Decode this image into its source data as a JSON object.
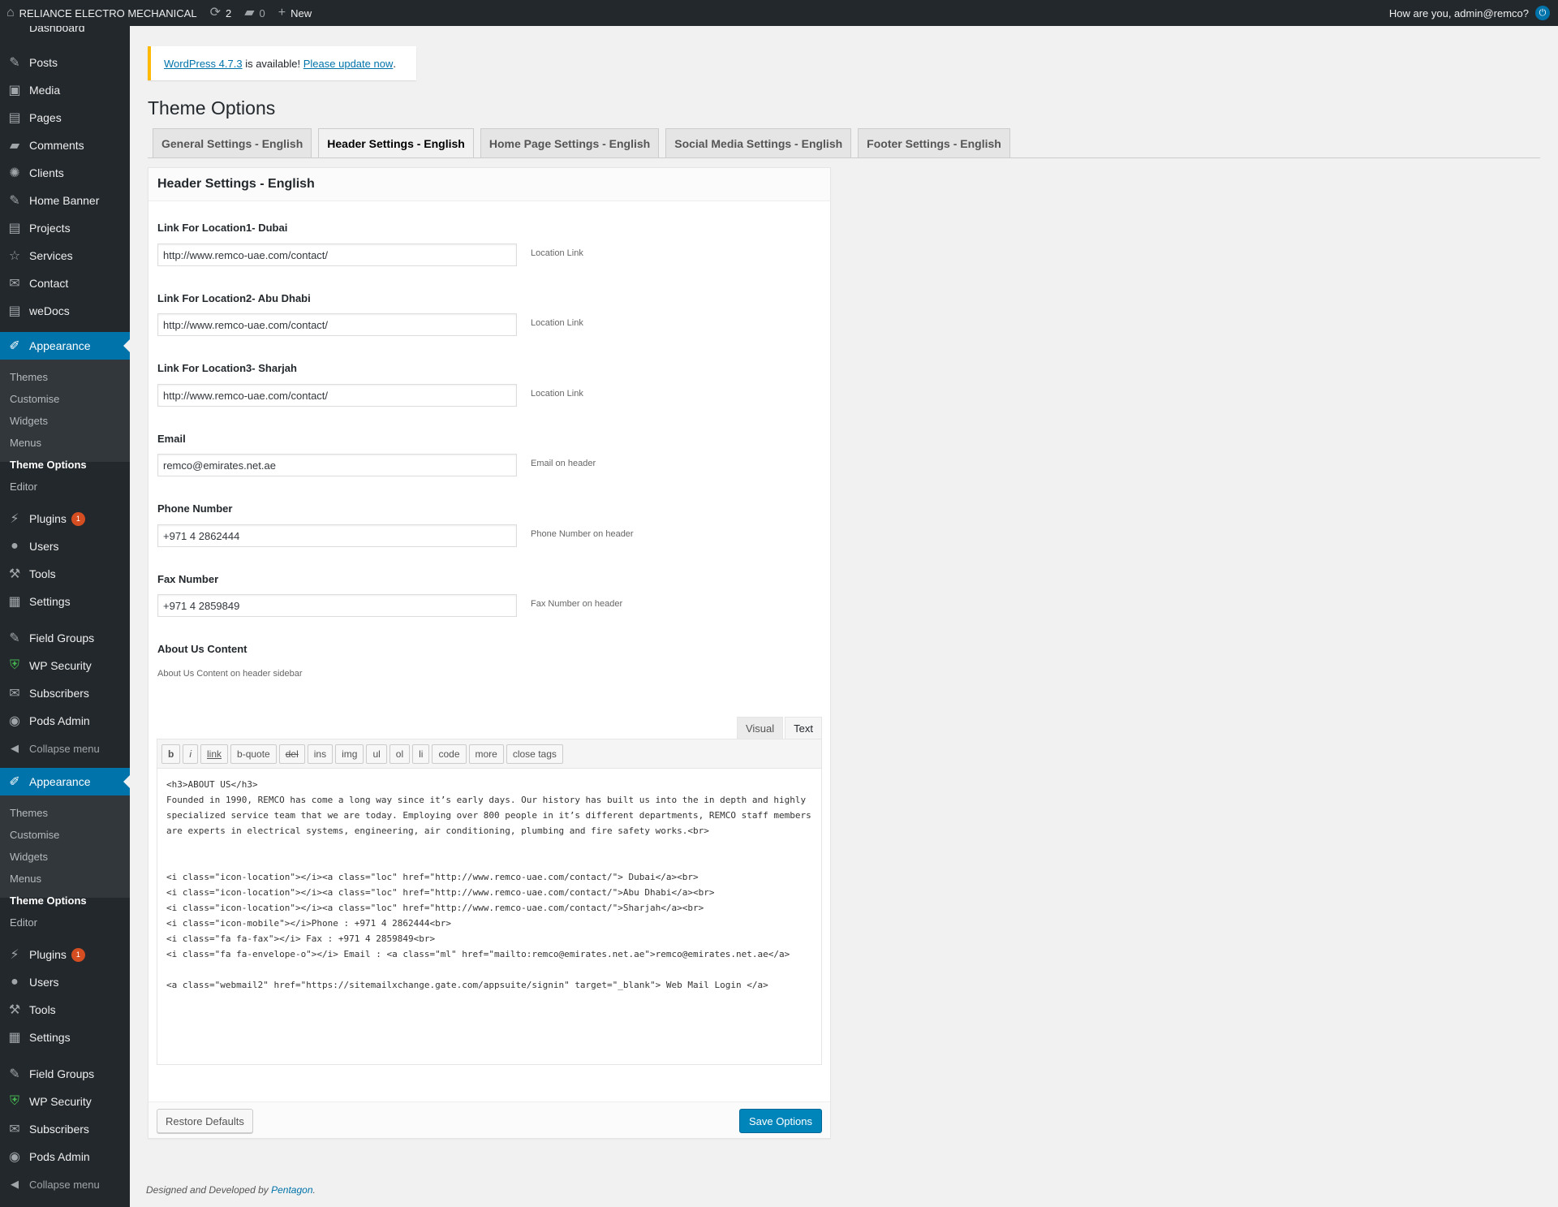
{
  "adminbar": {
    "site_name": "RELIANCE ELECTRO MECHANICAL",
    "updates_count": "2",
    "comments_count": "0",
    "new_label": "New",
    "greeting": "How are you, admin@remco?"
  },
  "sidebar": {
    "menu_partial_top": "Dashboard",
    "items": [
      {
        "label": "Posts",
        "icon": "pin-icon"
      },
      {
        "label": "Media",
        "icon": "media-icon"
      },
      {
        "label": "Pages",
        "icon": "pages-icon"
      },
      {
        "label": "Comments",
        "icon": "comments-icon"
      },
      {
        "label": "Clients",
        "icon": "clients-icon"
      },
      {
        "label": "Home Banner",
        "icon": "pin-icon"
      },
      {
        "label": "Projects",
        "icon": "pages-icon"
      },
      {
        "label": "Services",
        "icon": "star-icon"
      },
      {
        "label": "Contact",
        "icon": "mail-icon"
      },
      {
        "label": "weDocs",
        "icon": "pages-icon"
      }
    ],
    "appearance_label": "Appearance",
    "appearance_sub": [
      "Themes",
      "Customise",
      "Widgets",
      "Menus",
      "Theme Options",
      "Editor"
    ],
    "lower_items": [
      {
        "label": "Plugins",
        "badge": "1"
      },
      {
        "label": "Users"
      },
      {
        "label": "Tools"
      },
      {
        "label": "Settings"
      },
      {
        "label": "Field Groups"
      },
      {
        "label": "WP Security"
      },
      {
        "label": "Subscribers"
      },
      {
        "label": "Pods Admin"
      }
    ],
    "collapse_label": "Collapse menu"
  },
  "notice": {
    "link1": "WordPress 4.7.3",
    "text": " is available! ",
    "link2": "Please update now",
    "end": "."
  },
  "page": {
    "title": "Theme Options",
    "tabs": [
      "General Settings - English",
      "Header Settings - English",
      "Home Page Settings - English",
      "Social Media Settings - English",
      "Footer Settings - English"
    ],
    "active_tab": 1
  },
  "panel": {
    "header": "Header Settings - English",
    "fields": [
      {
        "label": "Link For Location1- Dubai",
        "value": "http://www.remco-uae.com/contact/",
        "desc": "Location Link"
      },
      {
        "label": "Link For Location2- Abu Dhabi",
        "value": "http://www.remco-uae.com/contact/",
        "desc": "Location Link"
      },
      {
        "label": "Link For Location3- Sharjah",
        "value": "http://www.remco-uae.com/contact/",
        "desc": "Location Link"
      },
      {
        "label": "Email",
        "value": "remco@emirates.net.ae",
        "desc": "Email on header"
      },
      {
        "label": "Phone Number",
        "value": "+971 4 2862444",
        "desc": "Phone Number on header"
      },
      {
        "label": "Fax Number",
        "value": "+971 4 2859849",
        "desc": "Fax Number on header"
      }
    ],
    "about_label": "About Us Content",
    "about_desc": "About Us Content on header sidebar",
    "editor_tabs": [
      "Visual",
      "Text"
    ],
    "quicktags": [
      "b",
      "i",
      "link",
      "b-quote",
      "del",
      "ins",
      "img",
      "ul",
      "ol",
      "li",
      "code",
      "more",
      "close tags"
    ],
    "editor_content": "<h3>ABOUT US</h3>\nFounded in 1990, REMCO has come a long way since it’s early days. Our history has built us into the in depth and highly specialized service team that we are today. Employing over 800 people in it’s different departments, REMCO staff members are experts in electrical systems, engineering, air conditioning, plumbing and fire safety works.<br>\n\n\n<i class=\"icon-location\"></i><a class=\"loc\" href=\"http://www.remco-uae.com/contact/\"> Dubai</a><br>\n<i class=\"icon-location\"></i><a class=\"loc\" href=\"http://www.remco-uae.com/contact/\">Abu Dhabi</a><br>\n<i class=\"icon-location\"></i><a class=\"loc\" href=\"http://www.remco-uae.com/contact/\">Sharjah</a><br>\n<i class=\"icon-mobile\"></i>Phone : +971 4 2862444<br>\n<i class=\"fa fa-fax\"></i> Fax : +971 4 2859849<br>\n<i class=\"fa fa-envelope-o\"></i> Email : <a class=\"ml\" href=\"mailto:remco@emirates.net.ae\">remco@emirates.net.ae</a>\n\n<a class=\"webmail2\" href=\"https://sitemailxchange.gate.com/appsuite/signin\" target=\"_blank\"> Web Mail Login </a>",
    "restore_label": "Restore Defaults",
    "save_label": "Save Options"
  },
  "footer": {
    "text": "Designed and Developed by ",
    "link": "Pentagon",
    "end": "."
  }
}
